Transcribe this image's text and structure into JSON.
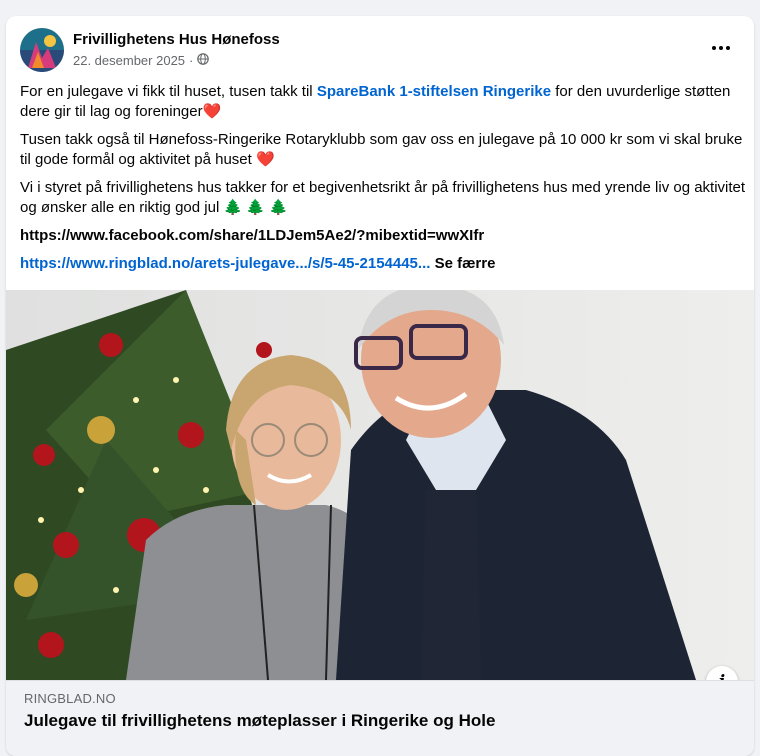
{
  "post": {
    "author": "Frivillighetens Hus Hønefoss",
    "date": "22. desember 2025",
    "audience_separator": "·",
    "audience_icon": "globe-icon",
    "more_icon": "more-options-icon",
    "p1_before": "For en julegave vi fikk til huset, tusen takk til ",
    "p1_link": "SpareBank 1-stiftelsen Ringerike",
    "p1_after": " for den uvurderlige støtten dere gir til lag og foreninger",
    "p2": "Tusen takk også til Hønefoss-Ringerike Rotaryklubb som gav oss en julegave på 10 000 kr som vi skal bruke til gode formål og aktivitet på huset ",
    "p3": "Vi i styret på frivillighetens hus takker for et begivenhetsrikt år på frivillighetens hus med yrende liv og aktivitet og ønsker alle en riktig god jul ",
    "heart_emoji": "❤️",
    "tree_emoji": "🌲 🌲 🌲",
    "url1": "https://www.facebook.com/share/1LDJem5Ae2/?mibextid=wwXIfr",
    "url2": "https://www.ringblad.no/arets-julegave.../s/5-45-2154445...",
    "see_less": "Se færre"
  },
  "link_preview": {
    "domain": "RINGBLAD.NO",
    "title": "Julegave til frivillighetens møteplasser i Ringerike og Hole",
    "info_icon": "info-icon"
  },
  "colors": {
    "link": "#0064d1",
    "secondary_text": "#65676b",
    "background": "#f0f2f5"
  }
}
